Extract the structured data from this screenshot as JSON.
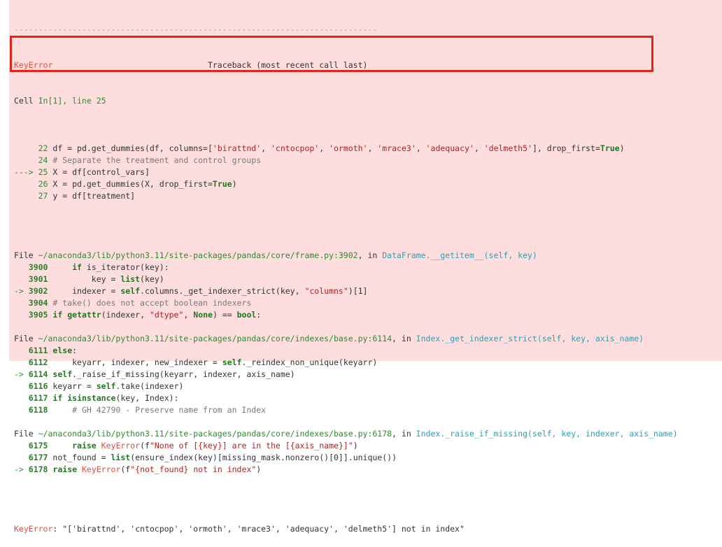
{
  "traceback": {
    "divider": "---------------------------------------------------------------------------",
    "error_name": "KeyError",
    "header_title": "Traceback (most recent call last)",
    "cell_prefix": "Cell ",
    "cell_ref": "In[1], line 25",
    "cell_lines": [
      {
        "arrow": "    ",
        "num": " 22",
        "pre": " df = pd.get_dummies(df, columns=[",
        "s1": "'birattnd'",
        "c1": ", ",
        "s2": "'cntocpop'",
        "c2": ", ",
        "s3": "'ormoth'",
        "c3": ", ",
        "s4": "'mrace3'",
        "c4": ", ",
        "s5": "'adequacy'",
        "c5": ", ",
        "s6": "'delmeth5'",
        "mid": "], drop_first=",
        "kw": "True",
        "post": ")"
      },
      {
        "arrow": "    ",
        "num": " 24",
        "comment": " # Separate the treatment and control groups"
      },
      {
        "arrow": "---> ",
        "num": "25",
        "text": " X = df[control_vars]"
      },
      {
        "arrow": "    ",
        "num": " 26",
        "pre": " X = pd.get_dummies(X, drop_first=",
        "kw": "True",
        "post": ")"
      },
      {
        "arrow": "    ",
        "num": " 27",
        "text": " y = df[treatment]"
      }
    ],
    "frames": [
      {
        "file_label": "File ",
        "path": "~/anaconda3/lib/python3.11/site-packages/pandas/core/frame.py:3902",
        "in_label": ", in ",
        "func": "DataFrame.__getitem__",
        "args": "(self, key)",
        "lines": [
          {
            "arrow": "   ",
            "num": "3900",
            "segs": [
              [
                "",
                "     "
              ],
              [
                "kw",
                "if"
              ],
              [
                "",
                " is_iterator(key):"
              ]
            ]
          },
          {
            "arrow": "   ",
            "num": "3901",
            "segs": [
              [
                "",
                "         key = "
              ],
              [
                "kw",
                "list"
              ],
              [
                "",
                "(key)"
              ]
            ]
          },
          {
            "arrow": "-> ",
            "num": "3902",
            "segs": [
              [
                "",
                "     indexer = "
              ],
              [
                "kw",
                "self"
              ],
              [
                "",
                ".columns._get_indexer_strict(key, "
              ],
              [
                "str",
                "\"columns\""
              ],
              [
                "",
                ")[1]"
              ]
            ]
          },
          {
            "arrow": "   ",
            "num": "3904",
            "segs": [
              [
                "comment",
                " # take() does not accept boolean indexers"
              ]
            ]
          },
          {
            "arrow": "   ",
            "num": "3905",
            "segs": [
              [
                "",
                " "
              ],
              [
                "kw",
                "if"
              ],
              [
                "",
                " "
              ],
              [
                "kw",
                "getattr"
              ],
              [
                "",
                "(indexer, "
              ],
              [
                "str",
                "\"dtype\""
              ],
              [
                "",
                ", "
              ],
              [
                "kw",
                "None"
              ],
              [
                "",
                ") == "
              ],
              [
                "kw",
                "bool"
              ],
              [
                "",
                ":"
              ]
            ]
          }
        ]
      },
      {
        "file_label": "File ",
        "path": "~/anaconda3/lib/python3.11/site-packages/pandas/core/indexes/base.py:6114",
        "in_label": ", in ",
        "func": "Index._get_indexer_strict",
        "args": "(self, key, axis_name)",
        "lines": [
          {
            "arrow": "   ",
            "num": "6111",
            "segs": [
              [
                "",
                " "
              ],
              [
                "kw",
                "else"
              ],
              [
                "",
                ":"
              ]
            ]
          },
          {
            "arrow": "   ",
            "num": "6112",
            "segs": [
              [
                "",
                "     keyarr, indexer, new_indexer = "
              ],
              [
                "kw",
                "self"
              ],
              [
                "",
                "._reindex_non_unique(keyarr)"
              ]
            ]
          },
          {
            "arrow": "-> ",
            "num": "6114",
            "segs": [
              [
                "",
                " "
              ],
              [
                "kw",
                "self"
              ],
              [
                "",
                "._raise_if_missing(keyarr, indexer, axis_name)"
              ]
            ]
          },
          {
            "arrow": "   ",
            "num": "6116",
            "segs": [
              [
                "",
                " keyarr = "
              ],
              [
                "kw",
                "self"
              ],
              [
                "",
                ".take(indexer)"
              ]
            ]
          },
          {
            "arrow": "   ",
            "num": "6117",
            "segs": [
              [
                "",
                " "
              ],
              [
                "kw",
                "if"
              ],
              [
                "",
                " "
              ],
              [
                "kw",
                "isinstance"
              ],
              [
                "",
                "(key, Index):"
              ]
            ]
          },
          {
            "arrow": "   ",
            "num": "6118",
            "segs": [
              [
                "comment",
                "     # GH 42790 - Preserve name from an Index"
              ]
            ]
          }
        ]
      },
      {
        "file_label": "File ",
        "path": "~/anaconda3/lib/python3.11/site-packages/pandas/core/indexes/base.py:6178",
        "in_label": ", in ",
        "func": "Index._raise_if_missing",
        "args": "(self, key, indexer, axis_name)",
        "lines": [
          {
            "arrow": "   ",
            "num": "6175",
            "segs": [
              [
                "",
                "     "
              ],
              [
                "kw",
                "raise"
              ],
              [
                "",
                " "
              ],
              [
                "red",
                "KeyError"
              ],
              [
                "",
                "(f"
              ],
              [
                "str",
                "\"None of [{key}] are in the [{axis_name}]\""
              ],
              [
                "",
                ")"
              ]
            ]
          },
          {
            "arrow": "   ",
            "num": "6177",
            "segs": [
              [
                "",
                " not_found = "
              ],
              [
                "kw",
                "list"
              ],
              [
                "",
                "(ensure_index(key)[missing_mask.nonzero()[0]].unique())"
              ]
            ]
          },
          {
            "arrow": "-> ",
            "num": "6178",
            "segs": [
              [
                "",
                " "
              ],
              [
                "kw",
                "raise"
              ],
              [
                "",
                " "
              ],
              [
                "red",
                "KeyError"
              ],
              [
                "",
                "(f"
              ],
              [
                "str",
                "\"{not_found} not in index\""
              ],
              [
                "",
                ")"
              ]
            ]
          }
        ]
      }
    ],
    "final_error_name": "KeyError",
    "final_message": ": \"['birattnd', 'cntocpop', 'ormoth', 'mrace3', 'adequacy', 'delmeth5'] not in index\""
  }
}
